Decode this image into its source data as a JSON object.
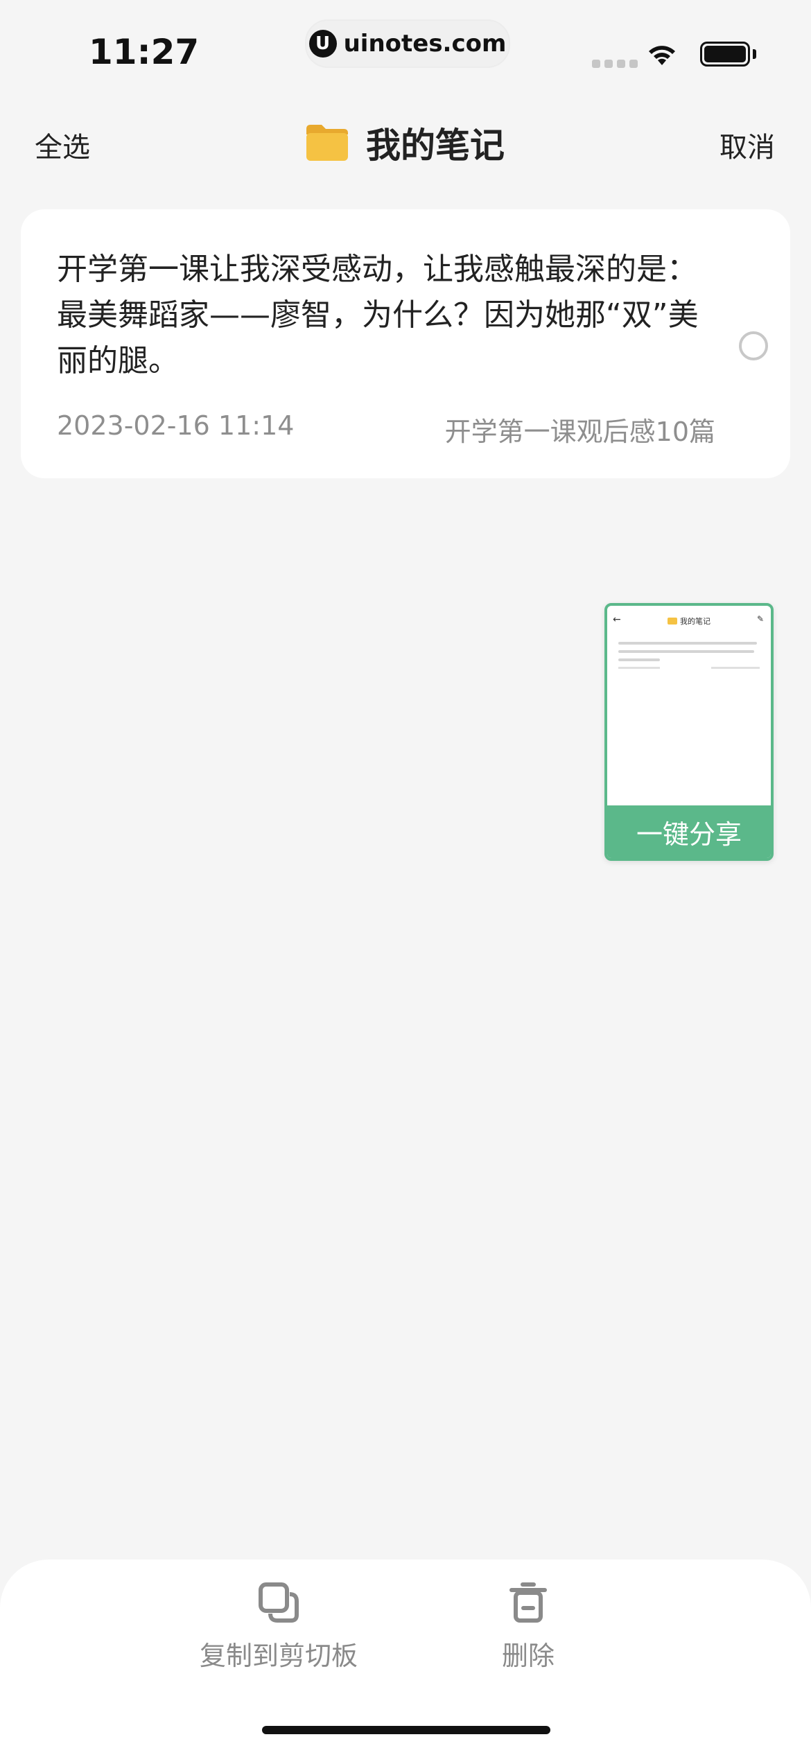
{
  "status_bar": {
    "time": "11:27",
    "url": "uinotes.com",
    "url_logo": "U",
    "icons": [
      "signal-icon",
      "wifi-icon",
      "battery-icon"
    ]
  },
  "nav": {
    "select_all": "全选",
    "title": "我的笔记",
    "cancel": "取消",
    "title_icon": "folder-icon"
  },
  "note": {
    "content": "开学第一课让我深受感动，让我感触最深的是：最美舞蹈家——廖智，为什么？因为她那“双”美丽的腿。",
    "date": "2023-02-16 11:14",
    "source": "开学第一课观后感10篇",
    "selected": false
  },
  "share_widget": {
    "button_label": "一键分享",
    "preview_title": "我的笔记"
  },
  "bottom_bar": {
    "copy_label": "复制到剪切板",
    "delete_label": "删除"
  },
  "colors": {
    "accent_green": "#5bb88a",
    "folder_yellow": "#f5c243",
    "background": "#f5f5f5"
  }
}
